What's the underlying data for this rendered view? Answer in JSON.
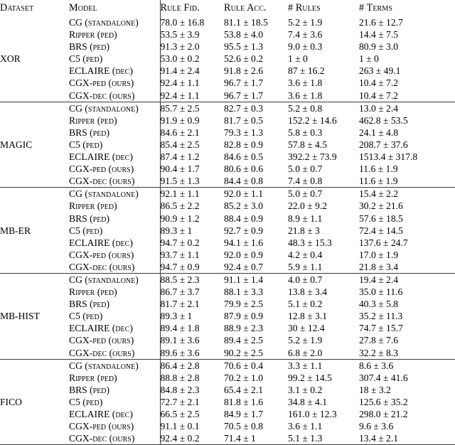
{
  "table": {
    "caption_present": false,
    "columns": [
      {
        "key": "dataset",
        "label": "Dataset"
      },
      {
        "key": "model",
        "label": "Model"
      },
      {
        "key": "fid",
        "label": "Rule Fid."
      },
      {
        "key": "acc",
        "label": "Rule Acc."
      },
      {
        "key": "rules",
        "label": "# Rules"
      },
      {
        "key": "terms",
        "label": "# Terms"
      }
    ],
    "models": [
      {
        "name": "CG",
        "suffix": "(standalone)"
      },
      {
        "name": "Ripper",
        "suffix": "(ped)"
      },
      {
        "name": "BRS",
        "suffix": "(ped)"
      },
      {
        "name": "C5",
        "suffix": "(ped)"
      },
      {
        "name": "ECLAIRE",
        "suffix": "(dec)"
      },
      {
        "name": "CGX-ped",
        "suffix": "(ours)"
      },
      {
        "name": "CGX-dec",
        "suffix": "(ours)"
      }
    ],
    "blocks": [
      {
        "dataset": "XOR",
        "rows": [
          {
            "model": "CG",
            "suffix": "(standalone)",
            "fid": "78.0 ± 16.8",
            "acc": "81.1 ± 18.5",
            "rules": "5.2 ± 1.9",
            "terms": "21.6 ± 12.7",
            "bold": {
              "fid": false,
              "acc": false,
              "rules": false,
              "terms": false
            }
          },
          {
            "model": "Ripper",
            "suffix": "(ped)",
            "fid": "53.5 ± 3.9",
            "acc": "53.8 ± 4.0",
            "rules": "7.4 ± 3.6",
            "terms": "14.4 ± 7.5",
            "bold": {
              "fid": false,
              "acc": false,
              "rules": false,
              "terms": false
            }
          },
          {
            "model": "BRS",
            "suffix": "(ped)",
            "fid": "91.3 ± 2.0",
            "acc": "95.5 ± 1.3",
            "rules": "9.0 ± 0.3",
            "terms": "80.9 ± 3.0",
            "bold": {
              "fid": false,
              "acc": false,
              "rules": false,
              "terms": false
            }
          },
          {
            "model": "C5",
            "suffix": "(ped)",
            "fid": "53.0 ± 0.2",
            "acc": "52.6 ± 0.2",
            "rules": "1 ± 0",
            "terms": "1 ± 0",
            "bold": {
              "fid": false,
              "acc": false,
              "rules": false,
              "terms": false
            }
          },
          {
            "model": "ECLAIRE",
            "suffix": "(dec)",
            "fid": "91.4 ± 2.4",
            "acc": "91.8 ± 2.6",
            "rules": "87 ± 16.2",
            "terms": "263 ± 49.1",
            "bold": {
              "fid": false,
              "acc": false,
              "rules": false,
              "terms": false
            }
          },
          {
            "model": "CGX-ped",
            "suffix": "(ours)",
            "fid": "92.4 ± 1.1",
            "acc": "96.7 ± 1.7",
            "rules": "3.6 ± 1.8",
            "terms": "10.4 ± 7.2",
            "bold": {
              "fid": true,
              "acc": true,
              "rules": true,
              "terms": true
            }
          },
          {
            "model": "CGX-dec",
            "suffix": "(ours)",
            "fid": "92.4 ± 1.1",
            "acc": "96.7 ± 1.7",
            "rules": "3.6 ± 1.8",
            "terms": "10.4 ± 7.2",
            "bold": {
              "fid": true,
              "acc": true,
              "rules": true,
              "terms": true
            }
          }
        ]
      },
      {
        "dataset": "MAGIC",
        "rows": [
          {
            "model": "CG",
            "suffix": "(standalone)",
            "fid": "85.7 ± 2.5",
            "acc": "82.7 ± 0.3",
            "rules": "5.2 ± 0.8",
            "terms": "13.0 ± 2.4",
            "bold": {
              "fid": false,
              "acc": false,
              "rules": false,
              "terms": false
            }
          },
          {
            "model": "Ripper",
            "suffix": "(ped)",
            "fid": "91.9 ± 0.9",
            "acc": "81.7 ± 0.5",
            "rules": "152.2 ± 14.6",
            "terms": "462.8 ± 53.5",
            "bold": {
              "fid": true,
              "acc": false,
              "rules": false,
              "terms": false
            }
          },
          {
            "model": "BRS",
            "suffix": "(ped)",
            "fid": "84.6 ± 2.1",
            "acc": "79.3 ± 1.3",
            "rules": "5.8 ± 0.3",
            "terms": "24.1 ± 4.8",
            "bold": {
              "fid": false,
              "acc": false,
              "rules": false,
              "terms": false
            }
          },
          {
            "model": "C5",
            "suffix": "(ped)",
            "fid": "85.4 ± 2.5",
            "acc": "82.8 ± 0.9",
            "rules": "57.8 ± 4.5",
            "terms": "208.7 ± 37.6",
            "bold": {
              "fid": false,
              "acc": false,
              "rules": false,
              "terms": false
            }
          },
          {
            "model": "ECLAIRE",
            "suffix": "(dec)",
            "fid": "87.4 ± 1.2",
            "acc": "84.6 ± 0.5",
            "rules": "392.2 ± 73.9",
            "terms": "1513.4 ± 317.8",
            "bold": {
              "fid": false,
              "acc": false,
              "rules": false,
              "terms": false
            }
          },
          {
            "model": "CGX-ped",
            "suffix": "(ours)",
            "fid": "90.4 ± 1.7",
            "acc": "80.6 ± 0.6",
            "rules": "5.0 ± 0.7",
            "terms": "11.6 ± 1.9",
            "bold": {
              "fid": false,
              "acc": false,
              "rules": true,
              "terms": true
            }
          },
          {
            "model": "CGX-dec",
            "suffix": "(ours)",
            "fid": "91.5 ± 1.3",
            "acc": "84.4 ± 0.8",
            "rules": "7.4 ± 0.8",
            "terms": "11.6 ± 1.9",
            "bold": {
              "fid": false,
              "acc": false,
              "rules": false,
              "terms": false
            }
          }
        ]
      },
      {
        "dataset": "MB-ER",
        "rows": [
          {
            "model": "CG",
            "suffix": "(standalone)",
            "fid": "92.1 ± 1.1",
            "acc": "92.0 ± 1.1",
            "rules": "5.0 ± 0.7",
            "terms": "15.4 ± 2.2",
            "bold": {
              "fid": false,
              "acc": false,
              "rules": false,
              "terms": false
            }
          },
          {
            "model": "Ripper",
            "suffix": "(ped)",
            "fid": "86.5 ± 2.2",
            "acc": "85.2 ± 3.0",
            "rules": "22.0 ± 9.2",
            "terms": "30.2 ± 21.6",
            "bold": {
              "fid": false,
              "acc": false,
              "rules": false,
              "terms": false
            }
          },
          {
            "model": "BRS",
            "suffix": "(ped)",
            "fid": "90.9 ± 1.2",
            "acc": "88.4 ± 0.9",
            "rules": "8.9 ± 1.1",
            "terms": "57.6 ± 18.5",
            "bold": {
              "fid": false,
              "acc": false,
              "rules": false,
              "terms": false
            }
          },
          {
            "model": "C5",
            "suffix": "(ped)",
            "fid": "89.3 ± 1",
            "acc": "92.7 ± 0.9",
            "rules": "21.8 ± 3",
            "terms": "72.4 ± 14.5",
            "bold": {
              "fid": false,
              "acc": false,
              "rules": false,
              "terms": false
            }
          },
          {
            "model": "ECLAIRE",
            "suffix": "(dec)",
            "fid": "94.7 ± 0.2",
            "acc": "94.1 ± 1.6",
            "rules": "48.3 ± 15.3",
            "terms": "137.6 ± 24.7",
            "bold": {
              "fid": true,
              "acc": true,
              "rules": false,
              "terms": false
            }
          },
          {
            "model": "CGX-ped",
            "suffix": "(ours)",
            "fid": "93.7 ± 1.1",
            "acc": "92.0 ± 0.9",
            "rules": "4.2 ± 0.4",
            "terms": "17.0 ± 1.9",
            "bold": {
              "fid": false,
              "acc": false,
              "rules": true,
              "terms": true
            }
          },
          {
            "model": "CGX-dec",
            "suffix": "(ours)",
            "fid": "94.7 ± 0.9",
            "acc": "92.4 ± 0.7",
            "rules": "5.9 ± 1.1",
            "terms": "21.8 ± 3.4",
            "bold": {
              "fid": true,
              "acc": false,
              "rules": false,
              "terms": false
            }
          }
        ]
      },
      {
        "dataset": "MB-HIST",
        "rows": [
          {
            "model": "CG",
            "suffix": "(standalone)",
            "fid": "88.5 ± 2.3",
            "acc": "91.1 ± 1.4",
            "rules": "4.0 ± 0.7",
            "terms": "19.4 ± 2.4",
            "bold": {
              "fid": false,
              "acc": false,
              "rules": false,
              "terms": false
            }
          },
          {
            "model": "Ripper",
            "suffix": "(ped)",
            "fid": "86.7 ± 3.7",
            "acc": "88.1 ± 3.3",
            "rules": "13.8 ± 3.4",
            "terms": "35.0 ± 11.6",
            "bold": {
              "fid": false,
              "acc": false,
              "rules": false,
              "terms": false
            }
          },
          {
            "model": "BRS",
            "suffix": "(ped)",
            "fid": "81.7 ± 2.1",
            "acc": "79.9 ± 2.5",
            "rules": "5.1 ± 0.2",
            "terms": "40.3 ± 5.8",
            "bold": {
              "fid": false,
              "acc": false,
              "rules": false,
              "terms": false
            }
          },
          {
            "model": "C5",
            "suffix": "(ped)",
            "fid": "89.3 ± 1",
            "acc": "87.9 ± 0.9",
            "rules": "12.8 ± 3.1",
            "terms": "35.2 ± 11.3",
            "bold": {
              "fid": false,
              "acc": false,
              "rules": false,
              "terms": false
            }
          },
          {
            "model": "ECLAIRE",
            "suffix": "(dec)",
            "fid": "89.4 ± 1.8",
            "acc": "88.9 ± 2.3",
            "rules": "30 ± 12.4",
            "terms": "74.7 ± 15.7",
            "bold": {
              "fid": false,
              "acc": false,
              "rules": false,
              "terms": false
            }
          },
          {
            "model": "CGX-ped",
            "suffix": "(ours)",
            "fid": "89.1 ± 3.6",
            "acc": "89.4 ± 2.5",
            "rules": "5.2 ± 1.9",
            "terms": "27.8 ± 7.6",
            "bold": {
              "fid": false,
              "acc": false,
              "rules": true,
              "terms": true
            }
          },
          {
            "model": "CGX-dec",
            "suffix": "(ours)",
            "fid": "89.6 ± 3.6",
            "acc": "90.2 ± 2.5",
            "rules": "6.8 ± 2.0",
            "terms": "32.2 ± 8.3",
            "bold": {
              "fid": true,
              "acc": true,
              "rules": false,
              "terms": false
            }
          }
        ]
      },
      {
        "dataset": "FICO",
        "rows": [
          {
            "model": "CG",
            "suffix": "(standalone)",
            "fid": "86.4 ± 2.8",
            "acc": "70.6 ± 0.4",
            "rules": "3.3 ± 1.1",
            "terms": "8.6 ± 3.6",
            "bold": {
              "fid": false,
              "acc": false,
              "rules": false,
              "terms": false
            }
          },
          {
            "model": "Ripper",
            "suffix": "(ped)",
            "fid": "88.8 ± 2.8",
            "acc": "70.2 ± 1.0",
            "rules": "99.2 ± 14.5",
            "terms": "307.4 ± 41.6",
            "bold": {
              "fid": false,
              "acc": false,
              "rules": false,
              "terms": false
            }
          },
          {
            "model": "BRS",
            "suffix": "(ped)",
            "fid": "84.8 ± 2.3",
            "acc": "65.4 ± 2.1",
            "rules": "3.1 ± 0.2",
            "terms": "18 ± 3.2",
            "bold": {
              "fid": false,
              "acc": false,
              "rules": false,
              "terms": false
            }
          },
          {
            "model": "C5",
            "suffix": "(ped)",
            "fid": "72.7 ± 2.1",
            "acc": "81.8 ± 1.6",
            "rules": "34.8 ± 4.1",
            "terms": "125.6 ± 35.2",
            "bold": {
              "fid": false,
              "acc": false,
              "rules": false,
              "terms": false
            }
          },
          {
            "model": "ECLAIRE",
            "suffix": "(dec)",
            "fid": "66.5 ± 2.5",
            "acc": "84.9 ± 1.7",
            "rules": "161.0 ± 12.3",
            "terms": "298.0 ± 21.2",
            "bold": {
              "fid": false,
              "acc": true,
              "rules": false,
              "terms": false
            }
          },
          {
            "model": "CGX-ped",
            "suffix": "(ours)",
            "fid": "91.1 ± 0.1",
            "acc": "70.5 ± 0.8",
            "rules": "3.6 ± 1.1",
            "terms": "9.6 ± 3.6",
            "bold": {
              "fid": false,
              "acc": false,
              "rules": true,
              "terms": true
            }
          },
          {
            "model": "CGX-dec",
            "suffix": "(ours)",
            "fid": "92.4 ± 0.2",
            "acc": "71.4 ± 1",
            "rules": "5.1 ± 1.3",
            "terms": "13.4 ± 2.1",
            "bold": {
              "fid": true,
              "acc": false,
              "rules": false,
              "terms": false
            }
          }
        ]
      }
    ]
  }
}
